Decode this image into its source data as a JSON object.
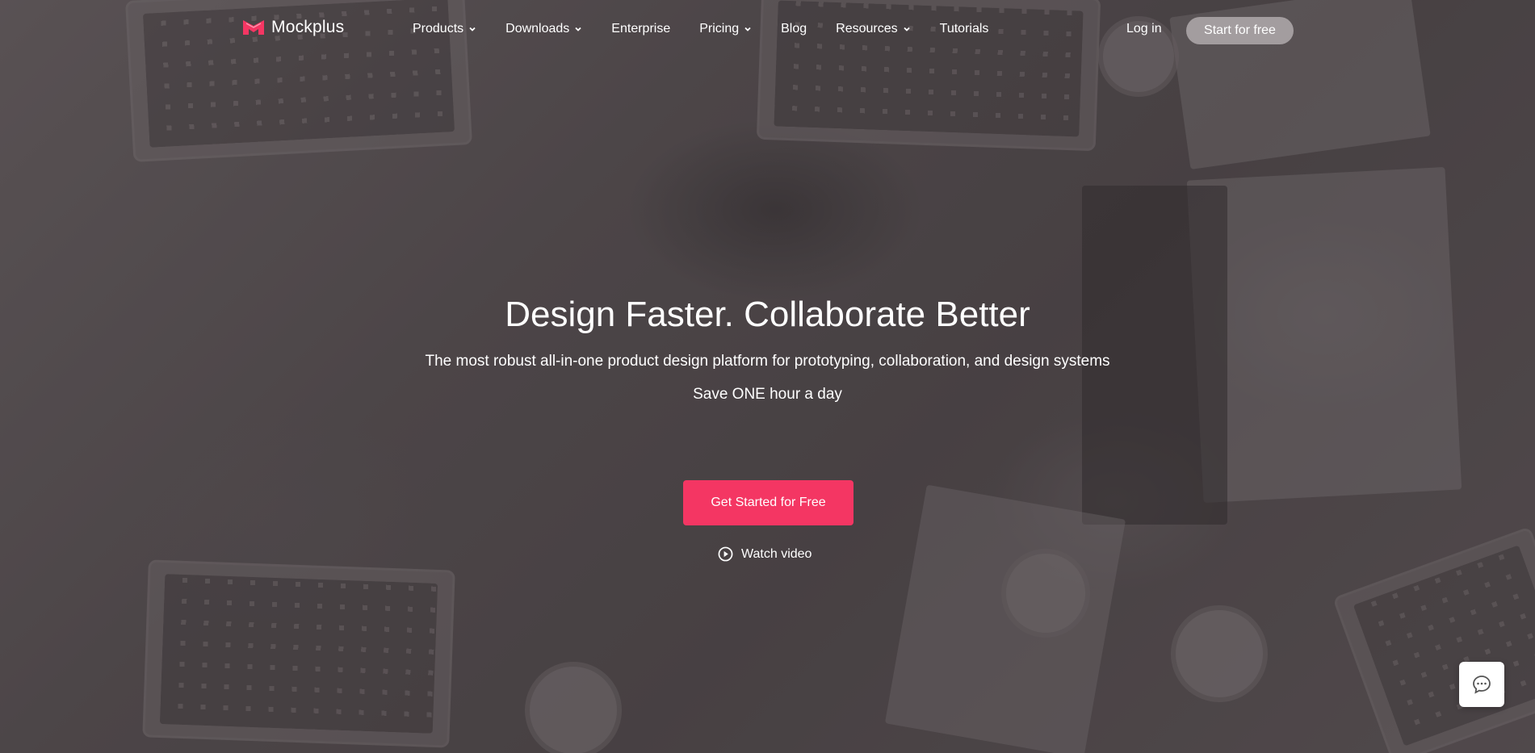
{
  "brand": {
    "name": "Mockplus",
    "accent_color": "#f43663",
    "logo_icon": "mockplus-logo-icon"
  },
  "nav": {
    "items": [
      {
        "label": "Products",
        "has_dropdown": true
      },
      {
        "label": "Downloads",
        "has_dropdown": true
      },
      {
        "label": "Enterprise",
        "has_dropdown": false
      },
      {
        "label": "Pricing",
        "has_dropdown": true
      },
      {
        "label": "Blog",
        "has_dropdown": false
      },
      {
        "label": "Resources",
        "has_dropdown": true
      },
      {
        "label": "Tutorials",
        "has_dropdown": false
      }
    ],
    "login_label": "Log in",
    "start_label": "Start for free"
  },
  "hero": {
    "headline": "Design Faster. Collaborate Better",
    "subheadline": "The most robust all-in-one product design platform for prototyping, collaboration, and design systems",
    "tagline": "Save ONE hour a day",
    "cta_label": "Get Started for Free",
    "video_label": "Watch video",
    "video_icon": "play-circle-icon"
  },
  "chat": {
    "icon": "chat-bubble-icon"
  }
}
